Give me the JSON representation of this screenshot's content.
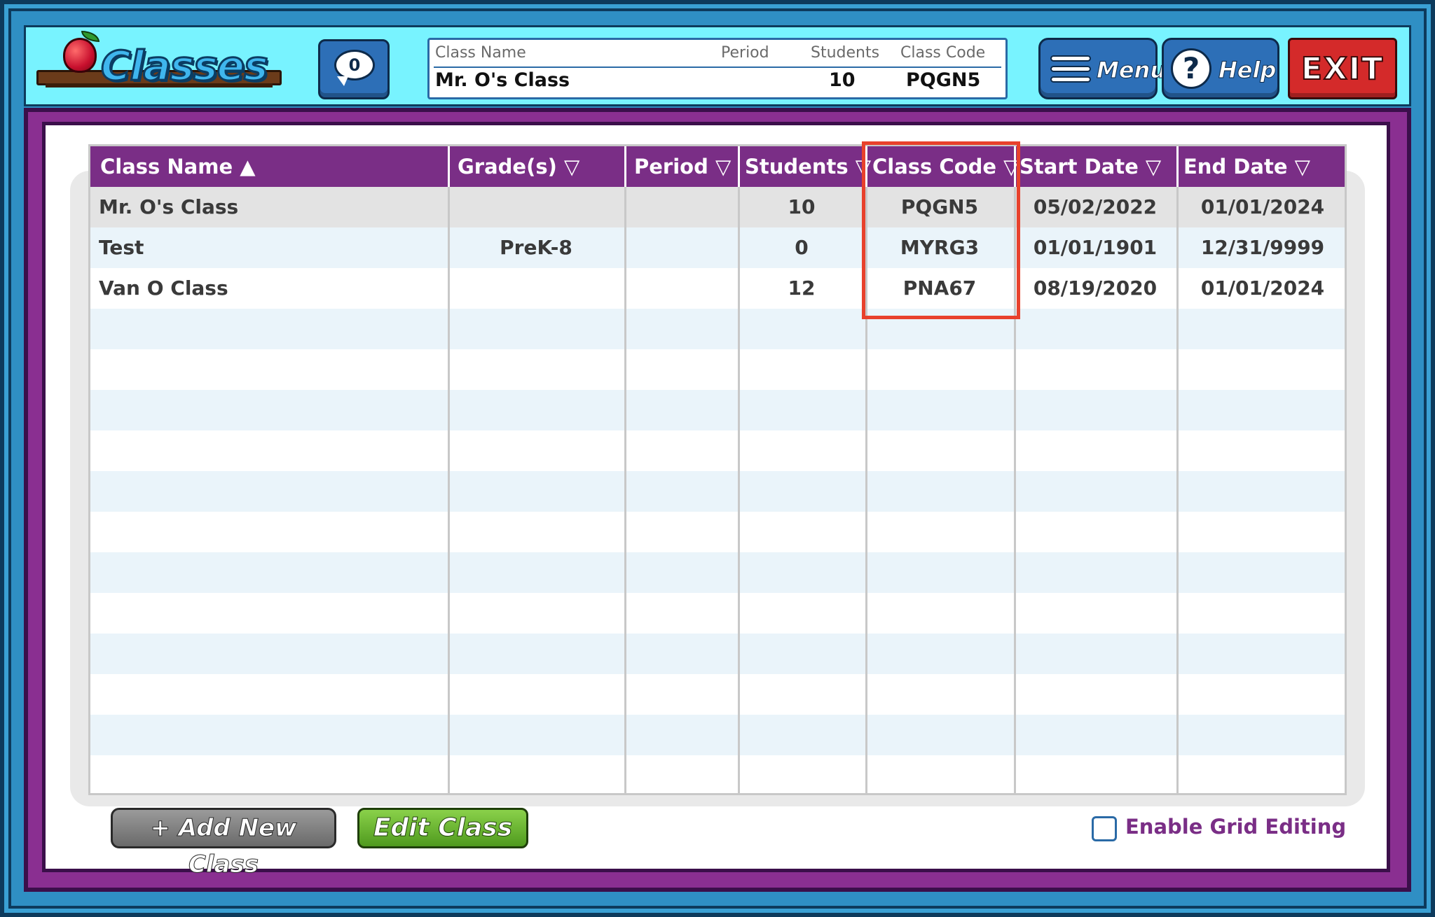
{
  "app": {
    "logo_text": "Classes"
  },
  "header": {
    "chat_count": "0",
    "info": {
      "class_name_label": "Class Name",
      "period_label": "Period",
      "students_label": "Students",
      "class_code_label": "Class Code",
      "class_name_value": "Mr. O's Class",
      "students_value": "10",
      "class_code_value": "PQGN5"
    },
    "menu_label": "Menu",
    "help_label": "Help",
    "help_symbol": "?",
    "exit_label": "EXIT"
  },
  "grid": {
    "columns": [
      {
        "label": "Class Name ▲"
      },
      {
        "label": "Grade(s) ▽"
      },
      {
        "label": "Period ▽"
      },
      {
        "label": "Students ▽"
      },
      {
        "label": "Class Code ▽"
      },
      {
        "label": "Start Date ▽"
      },
      {
        "label": "End Date ▽"
      }
    ],
    "rows": [
      {
        "class_name": "Mr. O's Class",
        "grades": "",
        "period": "",
        "students": "10",
        "class_code": "PQGN5",
        "start_date": "05/02/2022",
        "end_date": "01/01/2024"
      },
      {
        "class_name": "Test",
        "grades": "PreK-8",
        "period": "",
        "students": "0",
        "class_code": "MYRG3",
        "start_date": "01/01/1901",
        "end_date": "12/31/9999"
      },
      {
        "class_name": "Van O Class",
        "grades": "",
        "period": "",
        "students": "12",
        "class_code": "PNA67",
        "start_date": "08/19/2020",
        "end_date": "01/01/2024"
      }
    ]
  },
  "footer": {
    "add_button": "+ Add New Class",
    "edit_button": "Edit Class",
    "enable_grid_editing": "Enable Grid Editing"
  },
  "colors": {
    "header_bg": "#78f3ff",
    "purple": "#7a2e86",
    "highlight": "#e8412c",
    "selected_row": "#e3e3e3",
    "alt_row": "#eaf4fa"
  }
}
